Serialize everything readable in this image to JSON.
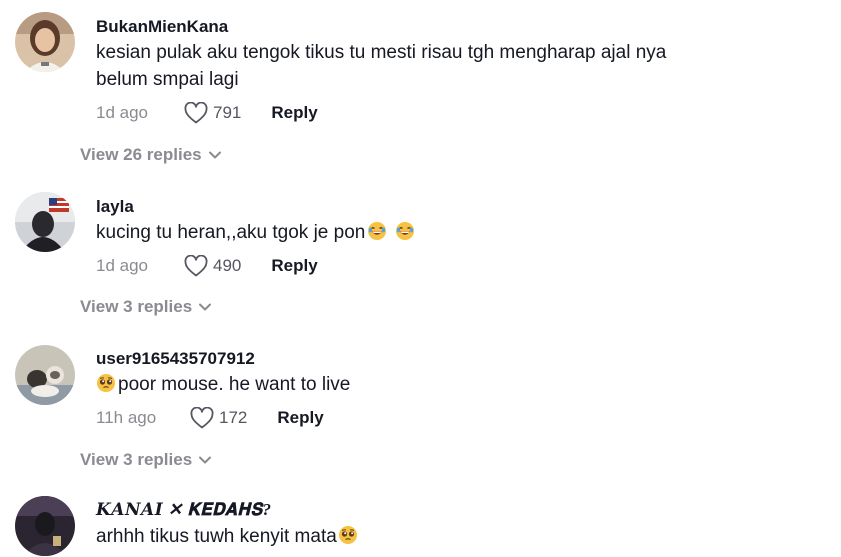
{
  "comments": [
    {
      "username": "BukanMienKana",
      "lines": [
        "kesian pulak aku tengok tikus tu mesti risau tgh mengharap ajal nya",
        "belum smpai lagi"
      ],
      "time": "1d ago",
      "likes": "791",
      "reply_label": "Reply",
      "view_replies": "View 26 replies"
    },
    {
      "username": "layla",
      "text": "kucing tu heran,,aku tgok je pon",
      "text_emojis": [
        "rolling-laughing-emoji",
        "rolling-laughing-emoji"
      ],
      "time": "1d ago",
      "likes": "490",
      "reply_label": "Reply",
      "view_replies": "View 3 replies"
    },
    {
      "username": "user9165435707912",
      "text": "poor mouse. he want to live",
      "text_emoji_prefix": "pleading-face-emoji",
      "time": "11h ago",
      "likes": "172",
      "reply_label": "Reply",
      "view_replies": "View 3 replies"
    },
    {
      "username": "𝑲𝑨𝑵𝑨𝑰 ✕ 𝐊𝐄𝐃𝐀𝐇𝐒?",
      "text": "arhhh tikus tuwh kenyit mata",
      "text_emoji_suffix": "pleading-face-emoji"
    }
  ],
  "icons": {
    "like": "heart-outline-icon",
    "expand": "chevron-down-icon"
  },
  "colors": {
    "text": "#161823",
    "muted": "#8a8b91",
    "background": "#ffffff"
  }
}
